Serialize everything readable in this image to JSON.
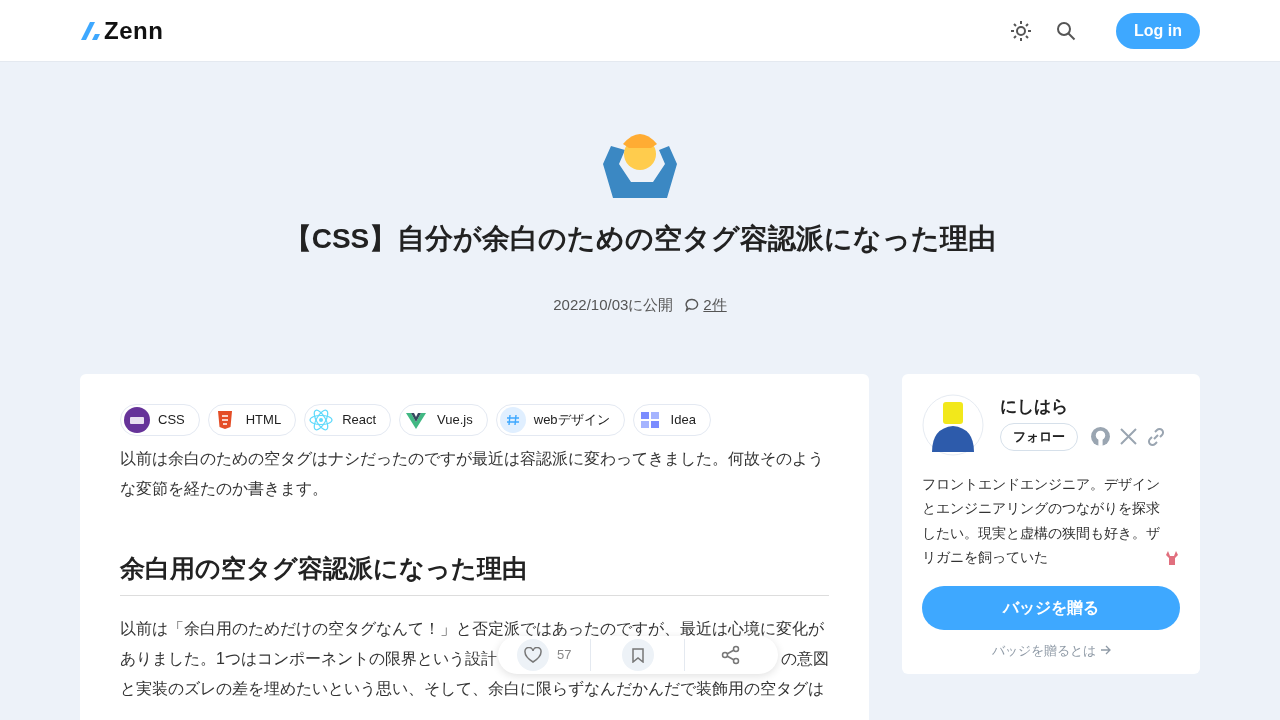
{
  "header": {
    "logo": "Zenn",
    "login": "Log in"
  },
  "article": {
    "title": "【CSS】自分が余白のための空タグ容認派になった理由",
    "published": "2022/10/03に公開",
    "comments": "2件"
  },
  "topics": [
    {
      "name": "CSS",
      "kind": "css"
    },
    {
      "name": "HTML",
      "kind": "html"
    },
    {
      "name": "React",
      "kind": "react"
    },
    {
      "name": "Vue.js",
      "kind": "vue"
    },
    {
      "name": "webデザイン",
      "kind": "hash"
    },
    {
      "name": "Idea",
      "kind": "grid"
    }
  ],
  "intro": "以前は余白のための空タグはナシだったのですが最近は容認派に変わってきました。何故そのような変節を経たのか書きます。",
  "heading": "余白用の空タグ容認派になった理由",
  "paragraph_lines": [
    [
      "以前は「余白用のためだけの空タグなんて！」と否定派ではあったのですが、最近は心境に変化が"
    ],
    [
      "ありました。1つはコンポーネントの限界という設計",
      "の意図"
    ],
    [
      "と実装のズレの差を埋めたいという思い、そして、余白に限らずなんだかんだで装飾用の空タグは"
    ]
  ],
  "actions": {
    "likes": "57"
  },
  "author": {
    "name": "にしはら",
    "follow": "フォロー",
    "bio": "フロントエンドエンジニア。デザインとエンジニアリングのつながりを探求したい。現実と虚構の狭間も好き。ザリガニを飼っていた",
    "badge_button": "バッジを贈る",
    "badge_link": "バッジを贈るとは"
  }
}
